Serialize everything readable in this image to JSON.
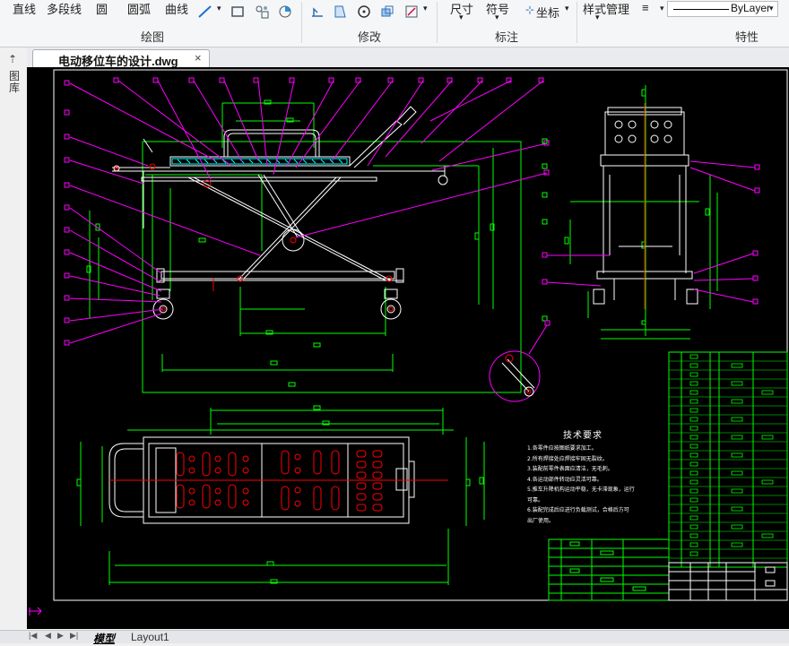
{
  "ribbon": {
    "draw_items": [
      "直线",
      "多段线",
      "圆",
      "圆弧",
      "曲线"
    ],
    "panels": {
      "draw": "绘图",
      "modify": "修改",
      "annotate": "标注",
      "properties": "特性"
    },
    "annotate_items": {
      "dimension": "尺寸",
      "symbol": "符号",
      "coordinate": "坐标"
    },
    "style_manager": "样式管理",
    "linetype": "ByLayer"
  },
  "document": {
    "tab_title": "电动移位车的设计.dwg",
    "close_glyph": "×"
  },
  "side_panel": {
    "label": "图库"
  },
  "drawing": {
    "tech_title": "技术要求",
    "notes": [
      "1.各零件应按图纸要求加工。",
      "2.所有焊接处应焊接牢固无裂纹。",
      "3.装配前零件表面应清洁，无毛刺。",
      "4.各运动部件转动应灵活可靠。",
      "5.推车升降机构运动平稳，无卡滞现象，运行",
      "  可靠。",
      "6.装配完成后应进行负载测试，合格后方可",
      "  出厂使用。"
    ]
  },
  "layout_tabs": [
    {
      "label": "模型",
      "active": true
    },
    {
      "label": "Layout1",
      "active": false
    }
  ],
  "colors": {
    "canvas": "#000000",
    "outline": "#ffffff",
    "dimension": "#00ff00",
    "leader": "#ff00ff",
    "center": "#ff0000",
    "hatch": "#00ffff",
    "border": "#ffffff"
  }
}
